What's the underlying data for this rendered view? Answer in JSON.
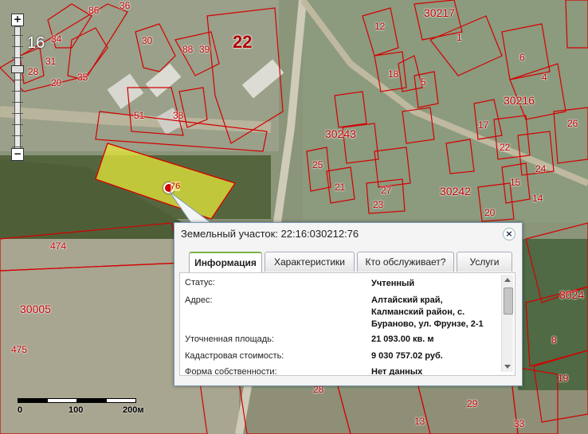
{
  "map": {
    "zoom_level": "16",
    "selected_parcel_label": "76",
    "labels": [
      {
        "id": "22",
        "text": "22",
        "big": true
      },
      {
        "id": "30217",
        "text": "30217"
      },
      {
        "id": "30216",
        "text": "30216"
      },
      {
        "id": "30243",
        "text": "30243"
      },
      {
        "id": "30242",
        "text": "30242"
      },
      {
        "id": "30005",
        "text": "30005"
      },
      {
        "id": "3024",
        "text": "3024"
      },
      {
        "id": "474",
        "text": "474"
      },
      {
        "id": "475",
        "text": "475"
      },
      {
        "id": "88",
        "text": "88"
      },
      {
        "id": "39",
        "text": "39"
      },
      {
        "id": "51",
        "text": "51"
      },
      {
        "id": "38",
        "text": "38"
      },
      {
        "id": "30",
        "text": "30"
      },
      {
        "id": "34",
        "text": "34"
      },
      {
        "id": "31",
        "text": "31"
      },
      {
        "id": "28",
        "text": "28"
      },
      {
        "id": "20",
        "text": "20"
      },
      {
        "id": "35",
        "text": "35"
      },
      {
        "id": "86",
        "text": "86"
      },
      {
        "id": "36",
        "text": "36"
      },
      {
        "id": "12",
        "text": "12"
      },
      {
        "id": "1",
        "text": "1"
      },
      {
        "id": "6",
        "text": "6"
      },
      {
        "id": "4",
        "text": "4"
      },
      {
        "id": "18",
        "text": "18"
      },
      {
        "id": "5",
        "text": "5"
      },
      {
        "id": "26",
        "text": "26"
      },
      {
        "id": "24",
        "text": "24"
      },
      {
        "id": "17",
        "text": "17"
      },
      {
        "id": "22b",
        "text": "22"
      },
      {
        "id": "27",
        "text": "27"
      },
      {
        "id": "23",
        "text": "23"
      },
      {
        "id": "21",
        "text": "21"
      },
      {
        "id": "15",
        "text": "15"
      },
      {
        "id": "14",
        "text": "14"
      },
      {
        "id": "20b",
        "text": "20"
      },
      {
        "id": "13",
        "text": "13"
      },
      {
        "id": "33",
        "text": "33"
      },
      {
        "id": "8",
        "text": "8"
      },
      {
        "id": "28b",
        "text": "28"
      },
      {
        "id": "19",
        "text": "19"
      },
      {
        "id": "29",
        "text": "29"
      },
      {
        "id": "25",
        "text": "25"
      }
    ],
    "scale": {
      "t0": "0",
      "t1": "100",
      "t2": "200м"
    }
  },
  "popup": {
    "title": "Земельный участок: 22:16:030212:76",
    "tabs": [
      "Информация",
      "Характеристики",
      "Кто обслуживает?",
      "Услуги"
    ],
    "active_tab": "Информация",
    "rows": [
      {
        "label": "Статус:",
        "value": "Учтенный"
      },
      {
        "label": "Адрес:",
        "value": "Алтайский край, Калманский район, с. Бураново, ул. Фрунзе, 2-1"
      },
      {
        "label": "Уточненная площадь:",
        "value": "21 093.00 кв. м"
      },
      {
        "label": "Кадастровая стоимость:",
        "value": "9 030 757.02 руб."
      },
      {
        "label": "Форма собственности:",
        "value": "Нет данных"
      }
    ]
  },
  "colors": {
    "parcel_border": "#d40000",
    "selected_fill": "#e6e83a",
    "active_tab_accent": "#7ab24a"
  }
}
